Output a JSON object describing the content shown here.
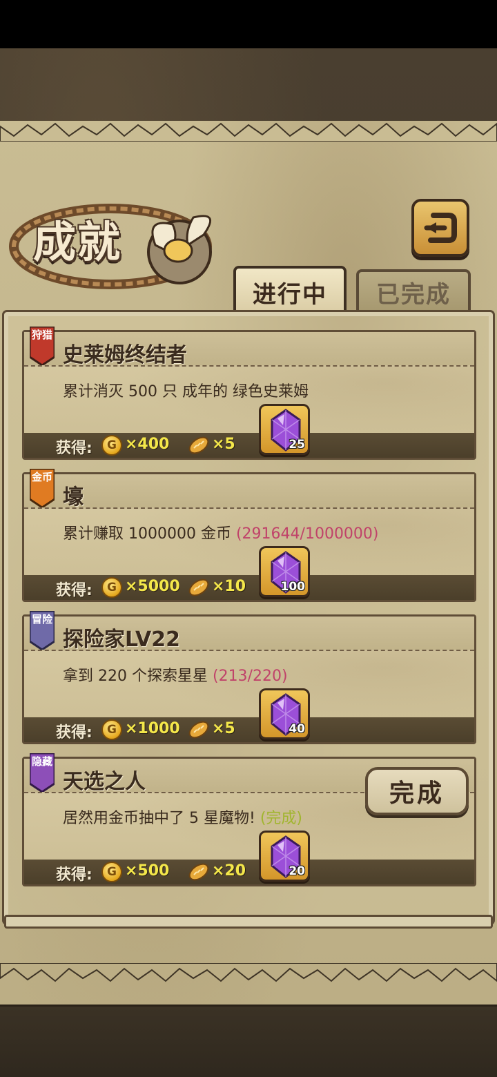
{
  "screen": {
    "title": "成就",
    "tabs": [
      {
        "label": "进行中",
        "active": true
      },
      {
        "label": "已完成",
        "active": false
      }
    ]
  },
  "reward_label": "获得:",
  "achievements": [
    {
      "badge": "狩猎",
      "badge_color": "#c0392b",
      "title": "史莱姆终结者",
      "description": "累计消灭 500 只 成年的 绿色史莱姆",
      "progress": "",
      "status": "",
      "coin_reward": "×400",
      "bread_reward": "×5",
      "gem_reward": "25"
    },
    {
      "badge": "金币",
      "badge_color": "#e07b22",
      "title": "壕",
      "description": "累计赚取 1000000 金币",
      "progress": "(291644/1000000)",
      "status": "",
      "coin_reward": "×5000",
      "bread_reward": "×10",
      "gem_reward": "100"
    },
    {
      "badge": "冒险",
      "badge_color": "#6f6aa8",
      "title": "探险家LV22",
      "description": "拿到 220 个探索星星",
      "progress": "(213/220)",
      "status": "",
      "coin_reward": "×1000",
      "bread_reward": "×5",
      "gem_reward": "40"
    },
    {
      "badge": "隐藏",
      "badge_color": "#8d4fb8",
      "title": "天选之人",
      "description": "居然用金币抽中了 5 星魔物!",
      "progress": "",
      "status": "(完成)",
      "coin_reward": "×500",
      "bread_reward": "×20",
      "gem_reward": "20",
      "complete_button": "完成"
    }
  ],
  "icons": {
    "coin": "coin-icon",
    "bread": "bread-icon",
    "gem": "purple-gem-icon",
    "back": "return-arrow-icon"
  },
  "colors": {
    "progress_text": "#c0436a",
    "done_text": "#a1b52e",
    "reward_amount": "#f4e74a"
  }
}
